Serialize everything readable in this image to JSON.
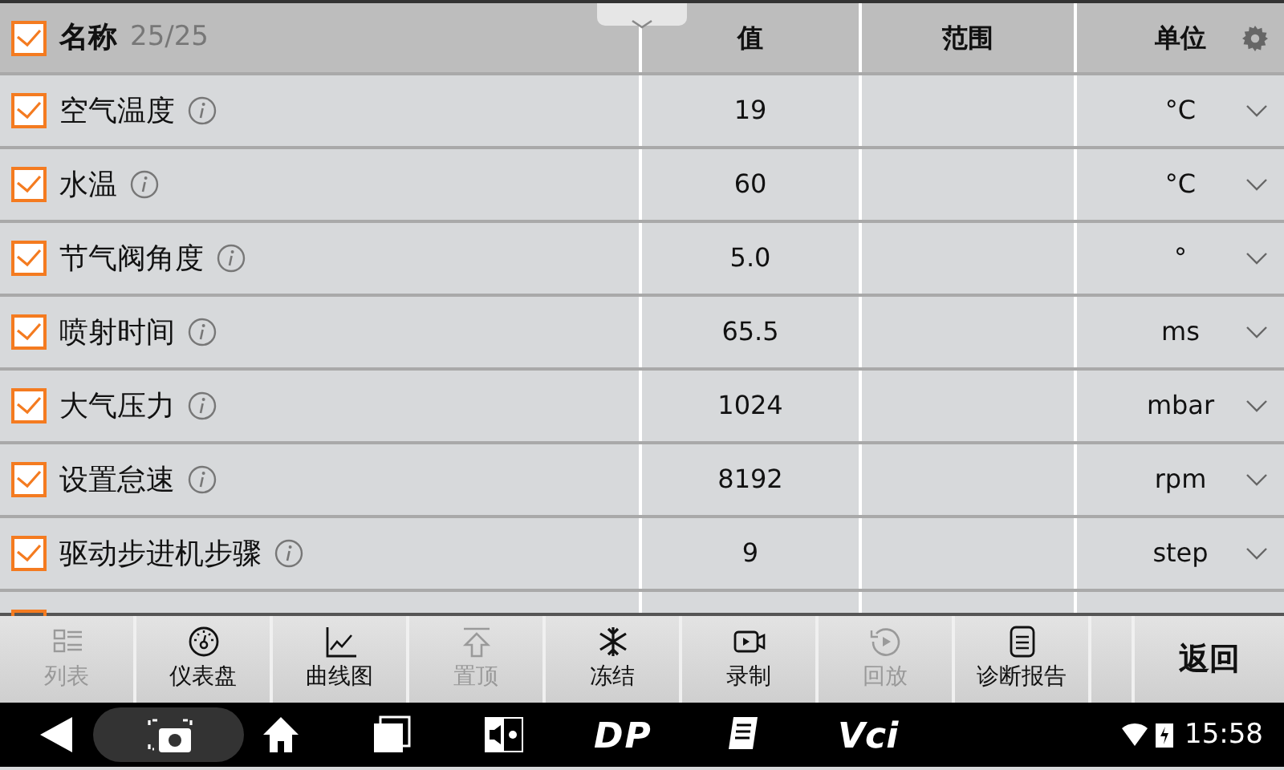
{
  "header": {
    "checked": true,
    "name": "名称",
    "count": "25/25",
    "value": "值",
    "range": "范围",
    "unit": "单位"
  },
  "rows": [
    {
      "checked": true,
      "name": "空气温度",
      "value": "19",
      "unit": "°C"
    },
    {
      "checked": true,
      "name": "水温",
      "value": "60",
      "unit": "°C"
    },
    {
      "checked": true,
      "name": "节气阀角度",
      "value": "5.0",
      "unit": "°"
    },
    {
      "checked": true,
      "name": "喷射时间",
      "value": "65.5",
      "unit": "ms"
    },
    {
      "checked": true,
      "name": "大气压力",
      "value": "1024",
      "unit": "mbar"
    },
    {
      "checked": true,
      "name": "设置怠速",
      "value": "8192",
      "unit": "rpm"
    },
    {
      "checked": true,
      "name": "驱动步进机步骤",
      "value": "9",
      "unit": "step"
    }
  ],
  "toolbar": [
    {
      "kind": "list",
      "label": "列表",
      "disabled": true
    },
    {
      "kind": "gauge",
      "label": "仪表盘",
      "disabled": false
    },
    {
      "kind": "chart",
      "label": "曲线图",
      "disabled": false
    },
    {
      "kind": "top",
      "label": "置顶",
      "disabled": true
    },
    {
      "kind": "freeze",
      "label": "冻结",
      "disabled": false
    },
    {
      "kind": "record",
      "label": "录制",
      "disabled": false
    },
    {
      "kind": "replay",
      "label": "回放",
      "disabled": true
    },
    {
      "kind": "report",
      "label": "诊断报告",
      "disabled": false
    }
  ],
  "back_button": "返回",
  "nav_bar": {
    "logo_1": "DP",
    "logo_2": "Vci",
    "time": "15:58"
  }
}
